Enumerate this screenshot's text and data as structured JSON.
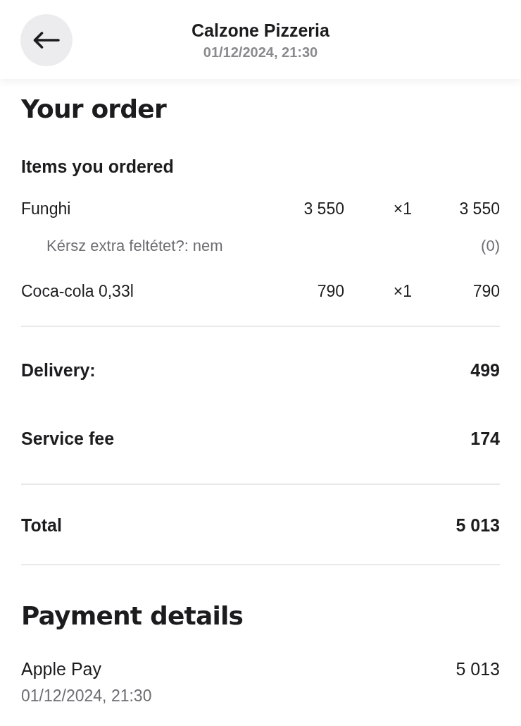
{
  "header": {
    "title": "Calzone Pizzeria",
    "subtitle": "01/12/2024, 21:30"
  },
  "order": {
    "heading": "Your order",
    "items_heading": "Items you ordered",
    "items": [
      {
        "name": "Funghi",
        "unit_price": "3 550",
        "quantity": "×1",
        "total": "3 550",
        "options": [
          {
            "label": "Kérsz extra feltétet?: nem",
            "price": "(0)"
          }
        ]
      },
      {
        "name": "Coca-cola 0,33l",
        "unit_price": "790",
        "quantity": "×1",
        "total": "790"
      }
    ],
    "fees": [
      {
        "label": "Delivery:",
        "amount": "499"
      },
      {
        "label": "Service fee",
        "amount": "174"
      }
    ],
    "total": {
      "label": "Total",
      "amount": "5 013"
    }
  },
  "payment": {
    "heading": "Payment details",
    "method": "Apple Pay",
    "date": "01/12/2024, 21:30",
    "amount": "5 013"
  }
}
